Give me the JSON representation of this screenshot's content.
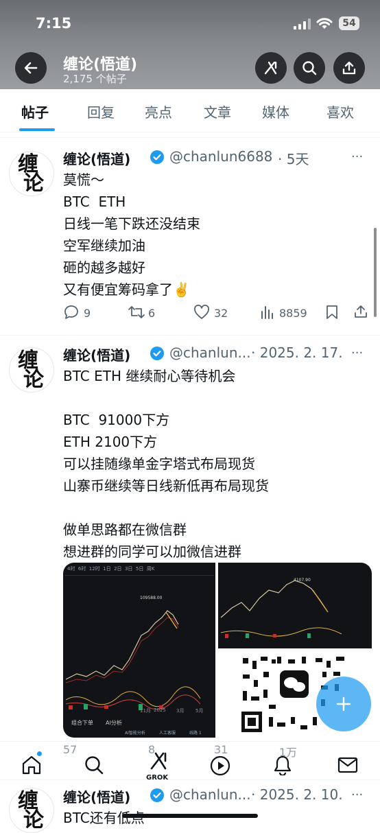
{
  "status_bar": {
    "time": "7:15",
    "battery": "54"
  },
  "header": {
    "title": "缠论(悟道)",
    "subtitle": "2,175 个帖子"
  },
  "tabs": [
    "帖子",
    "回复",
    "亮点",
    "文章",
    "媒体",
    "喜欢"
  ],
  "avatar_text": [
    "缠",
    "论"
  ],
  "posts": [
    {
      "name": "缠论(悟道)",
      "handle": "@chanlun6688",
      "time": "· 5天",
      "text": "莫慌～\nBTC  ETH\n日线一笔下跌还没结束\n空军继续加油\n砸的越多越好\n又有便宜筹码拿了✌️",
      "replies": "9",
      "reposts": "6",
      "likes": "32",
      "views": "8859"
    },
    {
      "name": "缠论(悟道)",
      "handle": "@chanlun...",
      "time": "· 2025. 2. 17.",
      "text": "BTC ETH 继续耐心等待机会\n\nBTC  91000下方\nETH 2100下方\n可以挂随缘单金字塔式布局现货\n山寨币继续等日线新低再布局现货\n\n做单思路都在微信群\n想进群的同学可以加微信进群",
      "replies": "57",
      "reposts": "8",
      "likes": "31",
      "views": "1万"
    },
    {
      "name": "缠论(悟道)",
      "handle": "@chanlun...",
      "time": "· 2025. 2. 10.",
      "text": "BTC还有低点"
    }
  ],
  "media": {
    "chart_toolbar": "4时  6时  12时  1日  2日  3日  5日  周K",
    "chart_price_left": "109588.00",
    "chart_price_right": "4107.90",
    "chart_axis": [
      "11月",
      "2025",
      "3月",
      "5月"
    ],
    "chart_tabs": [
      "组合下单",
      "AI分析"
    ],
    "chart_footer": [
      "AI智能分析",
      "人工客服",
      "线路 1"
    ]
  },
  "bottom_nav": {
    "grok_label": "GROK"
  },
  "colors": {
    "accent": "#1d9bf0",
    "verified": "#1d9bf0",
    "text": "#0f1419",
    "muted": "#536471"
  }
}
